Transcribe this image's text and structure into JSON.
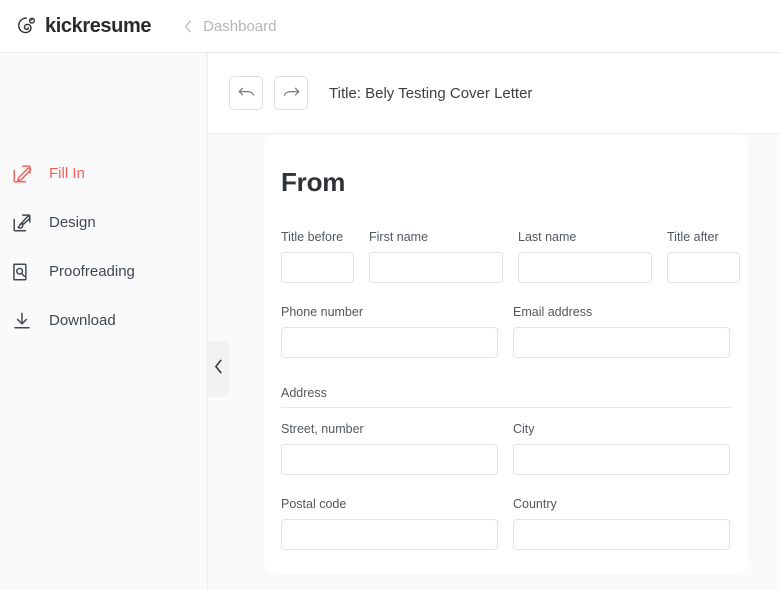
{
  "header": {
    "brand_name": "kickresume",
    "brand_icon": "kickresume-spiral-logo",
    "back_icon": "chevron-left-icon",
    "breadcrumb_label": "Dashboard"
  },
  "sidebar": {
    "items": [
      {
        "label": "Fill In",
        "icon": "pencil-edit-icon",
        "active": true
      },
      {
        "label": "Design",
        "icon": "paintbrush-icon",
        "active": false
      },
      {
        "label": "Proofreading",
        "icon": "document-magnifier-icon",
        "active": false
      },
      {
        "label": "Download",
        "icon": "download-arrow-icon",
        "active": false
      }
    ],
    "active_color": "#f7615b",
    "inactive_color": "#41474f"
  },
  "toolbar": {
    "undo_icon": "undo-arrow-icon",
    "redo_icon": "redo-arrow-icon",
    "undo_label": "Undo",
    "redo_label": "Redo",
    "document_title": "Title: Bely Testing Cover Letter"
  },
  "canvas": {
    "collapse_icon": "chevron-left-icon",
    "collapse_label": "Collapse panel"
  },
  "form": {
    "section_title": "From",
    "name_row": [
      {
        "label": "Title before",
        "value": "",
        "placeholder": ""
      },
      {
        "label": "First name",
        "value": "",
        "placeholder": ""
      },
      {
        "label": "Last name",
        "value": "",
        "placeholder": ""
      },
      {
        "label": "Title after",
        "value": "",
        "placeholder": ""
      }
    ],
    "contact_row": [
      {
        "label": "Phone number",
        "value": "",
        "placeholder": ""
      },
      {
        "label": "Email address",
        "value": "",
        "placeholder": ""
      }
    ],
    "address": {
      "group_label": "Address",
      "street_row": [
        {
          "label": "Street, number",
          "value": "",
          "placeholder": ""
        },
        {
          "label": "City",
          "value": "",
          "placeholder": ""
        }
      ],
      "postal_row": [
        {
          "label": "Postal code",
          "value": "",
          "placeholder": ""
        },
        {
          "label": "Country",
          "value": "",
          "placeholder": ""
        }
      ]
    }
  },
  "colors": {
    "accent": "#f7615b",
    "page_bg": "#fafafa",
    "card_bg": "#ffffff",
    "border": "#ededed",
    "text": "#3c4043",
    "muted_text": "#b6b6b6"
  }
}
